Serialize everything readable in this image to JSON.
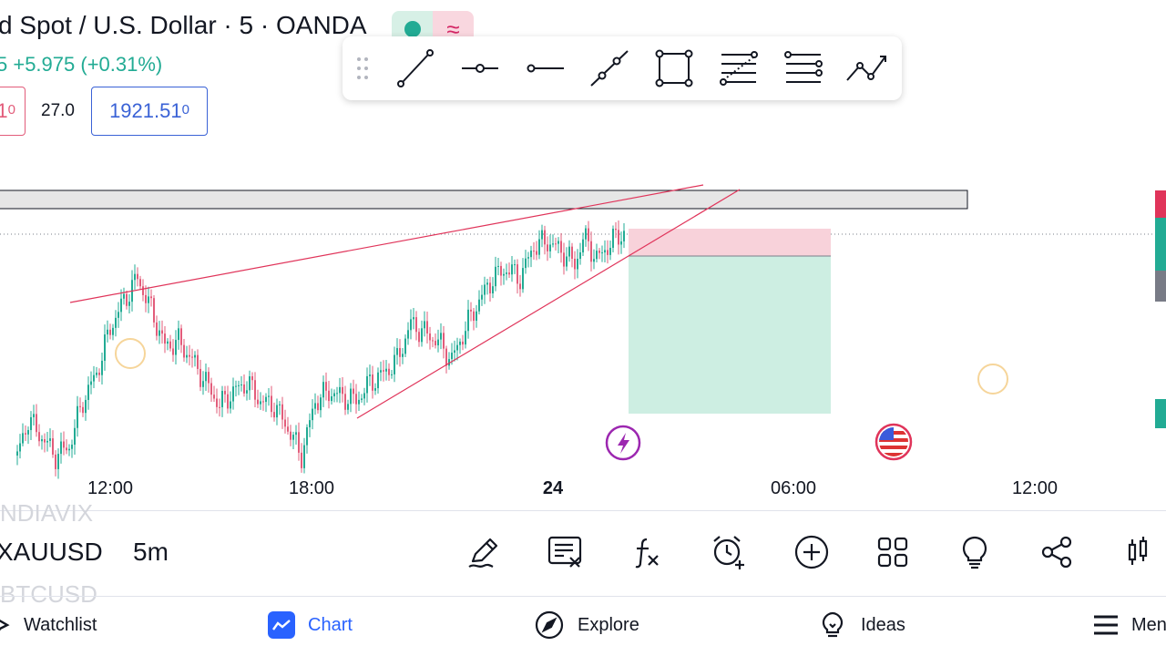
{
  "header": {
    "title": "d Spot / U.S. Dollar · 5 · OANDA",
    "change": "5  +5.975 (+0.31%)",
    "bid": "1",
    "bid_sup": "0",
    "spread": "27.0",
    "ask": "1921.51",
    "ask_sup": "0",
    "badge_wave": "≈"
  },
  "drawing_toolbar": {
    "tools": [
      "trend-line",
      "horizontal-ray",
      "horizontal-line",
      "extended-line",
      "rectangle",
      "fib-retracement",
      "parallel-channel",
      "path"
    ]
  },
  "chart": {
    "time_labels": [
      "12:00",
      "18:00",
      "24",
      "06:00",
      "12:00"
    ],
    "colors": {
      "up": "#22ab94",
      "down": "#e25c7a",
      "line": "#e0345a",
      "stop_zone": "#f8d2da",
      "target_zone": "#cdeee2"
    },
    "events": [
      "lightning-event-icon",
      "us-flag-event-icon"
    ]
  },
  "bottom_toolbar": {
    "symbol_prev": "NDIAVIX",
    "symbol": "XAUUSD",
    "symbol_next": "BTCUSD",
    "interval": "5m",
    "icons": [
      "pencil-icon",
      "checklist-icon",
      "fx-icon",
      "alarm-icon",
      "plus-circle-icon",
      "grid-icon",
      "lightbulb-icon",
      "share-icon",
      "candles-icon"
    ]
  },
  "nav": {
    "watchlist": "Watchlist",
    "chart": "Chart",
    "explore": "Explore",
    "ideas": "Ideas",
    "menu": "Menu"
  }
}
